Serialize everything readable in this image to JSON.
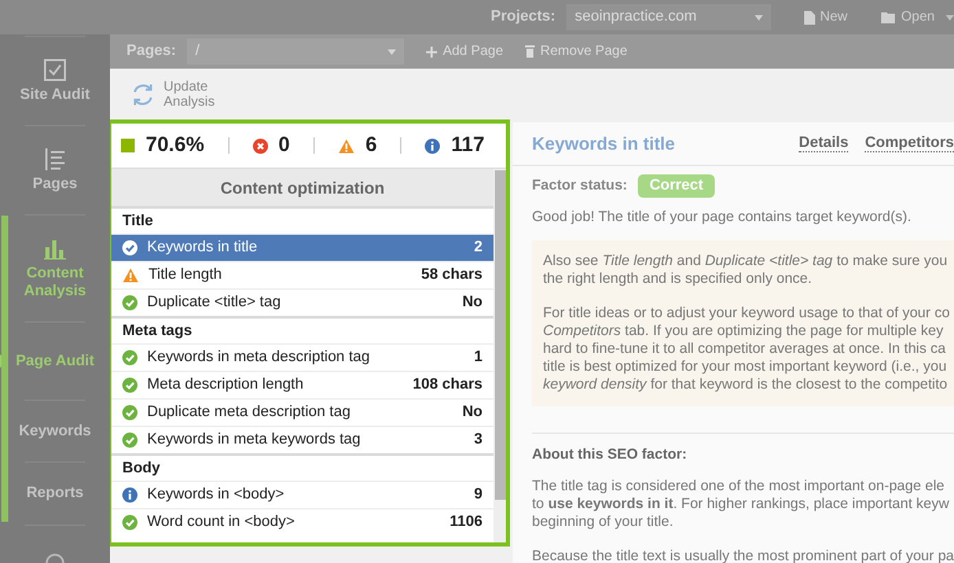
{
  "top_bar": {
    "projects_label": "Projects:",
    "project": "seoinpractice.com",
    "buttons": [
      {
        "label": "New",
        "kind": "new"
      },
      {
        "label": "Open",
        "kind": "open"
      }
    ]
  },
  "sidebar": {
    "items": [
      {
        "label": "Site Audit",
        "kind": "audit",
        "active": false,
        "selected": false
      },
      {
        "label": "Pages",
        "kind": "pages",
        "active": false,
        "selected": false
      },
      {
        "label": "Content Analysis",
        "kind": "content",
        "active": true,
        "selected": false
      },
      {
        "label": "Page Audit",
        "kind": "text",
        "active": true,
        "selected": true
      },
      {
        "label": "Keywords",
        "kind": "text",
        "active": false,
        "selected": false
      },
      {
        "label": "Reports",
        "kind": "text",
        "active": false,
        "selected": false
      }
    ]
  },
  "pages_bar": {
    "label": "Pages:",
    "value": "/",
    "buttons": [
      {
        "label": "Add Page",
        "kind": "add"
      },
      {
        "label": "Remove Page",
        "kind": "remove"
      }
    ]
  },
  "toolbar": {
    "update_button": "Update Analysis"
  },
  "summary": {
    "score": "70.6%",
    "errors": "0",
    "warnings": "6",
    "info": "117"
  },
  "factors": {
    "title": "Content optimization",
    "sections": [
      {
        "title": "Title",
        "rows": [
          {
            "label": "Keywords in title",
            "value": "2",
            "kind": "correct",
            "selected": true
          },
          {
            "label": "Title length",
            "value": "58 chars",
            "kind": "warning",
            "selected": false
          },
          {
            "label": "Duplicate <title> tag",
            "value": "No",
            "kind": "correct",
            "selected": false
          }
        ]
      },
      {
        "title": "Meta tags",
        "rows": [
          {
            "label": "Keywords in meta description tag",
            "value": "1",
            "kind": "correct",
            "selected": false
          },
          {
            "label": "Meta description length",
            "value": "108 chars",
            "kind": "correct",
            "selected": false
          },
          {
            "label": "Duplicate meta description tag",
            "value": "No",
            "kind": "correct",
            "selected": false
          },
          {
            "label": "Keywords in meta keywords tag",
            "value": "3",
            "kind": "correct",
            "selected": false
          }
        ]
      },
      {
        "title": "Body",
        "rows": [
          {
            "label": "Keywords in <body>",
            "value": "9",
            "kind": "info",
            "selected": false
          },
          {
            "label": "Word count in <body>",
            "value": "1106",
            "kind": "correct",
            "selected": false
          }
        ]
      }
    ]
  },
  "detail": {
    "title": "Keywords in title",
    "tabs": [
      "Details",
      "Competitors"
    ],
    "factor_status_label": "Factor status:",
    "factor_status": "Correct",
    "message": "Good job! The title of your page contains target keyword(s).",
    "tips": [
      {
        "lines": [
          "Also see *Title length* and *Duplicate <title> tag* to make sure you",
          "the right length and is specified only once."
        ]
      },
      {
        "lines": [
          "For title ideas or to adjust your keyword usage to that of your co",
          "*Competitors* tab. If you are optimizing the page for multiple key",
          "hard to fine-tune it to all competitor averages at once. In this ca",
          "title is best optimized for your most important keyword (i.e., you",
          "*keyword density* for that keyword is the closest to the competito"
        ]
      }
    ],
    "about_title": "About this SEO factor:",
    "about": [
      {
        "lines": [
          "The title tag is considered one of the most important on-page ele",
          "to **use keywords in it**. For higher rankings, place important keyw",
          "beginning of your title."
        ]
      },
      {
        "lines": [
          "Because the title text is usually the most prominent part of your pa"
        ]
      }
    ]
  }
}
